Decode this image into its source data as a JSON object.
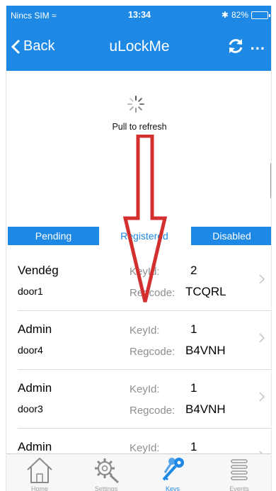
{
  "status_bar": {
    "carrier": "Nincs SIM",
    "time": "13:34",
    "battery": "82%",
    "battery_level": 0.82
  },
  "nav": {
    "back_label": "Back",
    "title": "uLockMe",
    "refresh_icon": "refresh-icon",
    "more": "..."
  },
  "refresh": {
    "text": "Pull to refresh"
  },
  "segments": {
    "pending": "Pending",
    "registered": "Registered",
    "disabled": "Disabled"
  },
  "list": {
    "key_label": "KeyId:",
    "reg_label": "Regcode:",
    "rows": [
      {
        "name": "Vendég",
        "door": "door1",
        "key": "2",
        "reg": "TCQRL"
      },
      {
        "name": "Admin",
        "door": "door4",
        "key": "1",
        "reg": "B4VNH"
      },
      {
        "name": "Admin",
        "door": "door3",
        "key": "1",
        "reg": "B4VNH"
      },
      {
        "name": "Admin",
        "door": "",
        "key": "1",
        "reg": ""
      }
    ]
  },
  "tabs": [
    {
      "label": "Home",
      "icon": "home-icon"
    },
    {
      "label": "Settings",
      "icon": "settings-icon"
    },
    {
      "label": "Keys",
      "icon": "keys-icon"
    },
    {
      "label": "Events",
      "icon": "events-icon"
    }
  ],
  "colors": {
    "accent": "#1e88e5",
    "arrow": "#d32f2f"
  }
}
